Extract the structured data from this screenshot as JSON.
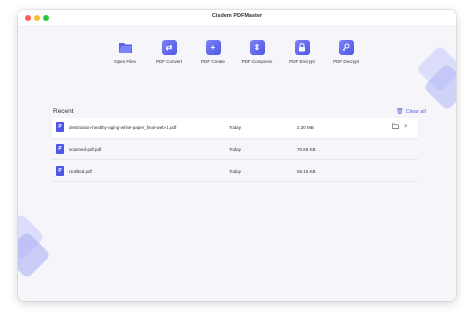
{
  "app": {
    "title": "Cisdem PDFMaster"
  },
  "tools": [
    {
      "label": "Open Files",
      "icon": "folder-icon"
    },
    {
      "label": "PDF Convert",
      "icon": "convert-icon"
    },
    {
      "label": "PDF Create",
      "icon": "plus-icon"
    },
    {
      "label": "PDF Compress",
      "icon": "compress-icon"
    },
    {
      "label": "PDF Encrypt",
      "icon": "lock-icon"
    },
    {
      "label": "PDF Decrypt",
      "icon": "key-icon"
    }
  ],
  "recent": {
    "title": "Recent",
    "clear_label": "Clear all",
    "files": [
      {
        "name": "destination-healthy-aging-white-paper_final-web-1.pdf",
        "date": "Today",
        "size": "2.30 MB"
      },
      {
        "name": "scanned-pdf.pdf",
        "date": "Today",
        "size": "70.69 KB"
      },
      {
        "name": "Untitled.pdf",
        "date": "Today",
        "size": "59.15 KB"
      }
    ]
  },
  "colors": {
    "accent": "#5a5fe0",
    "background": "#f6f6fa"
  }
}
